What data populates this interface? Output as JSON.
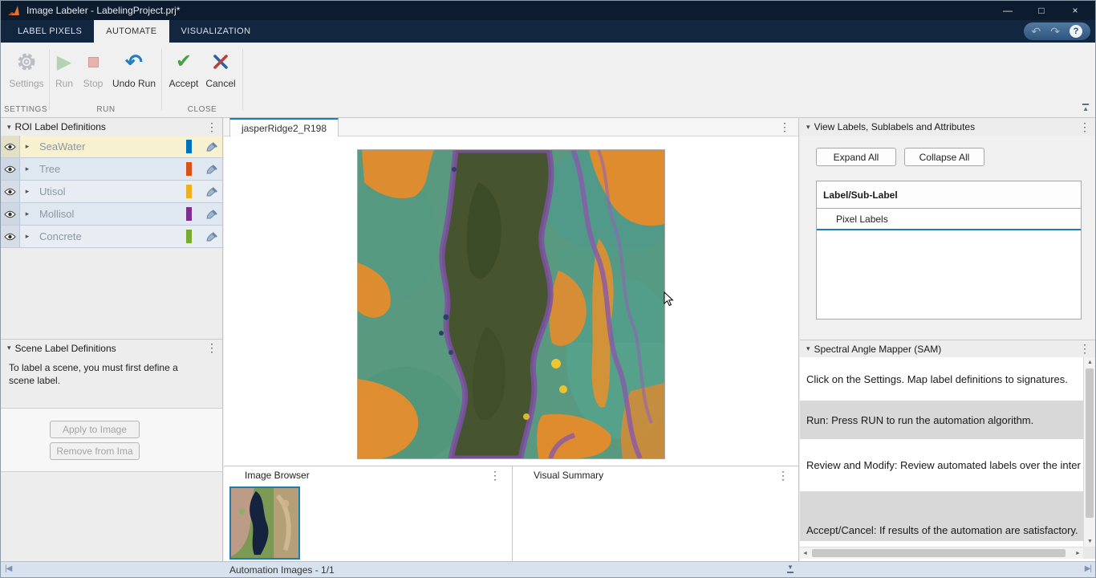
{
  "theme": {
    "titlebar_bg": "#0d1b2e",
    "accent_blue": "#1e7ab8",
    "selected_row_bg": "#f8f1cf"
  },
  "glyphs": {
    "collapse": "▾",
    "kebab": "⋮",
    "expander": "▸",
    "minimize": "—",
    "maximize": "□",
    "close": "×",
    "undo": "↶",
    "redo": "↷",
    "help": "?",
    "run": "▶",
    "accept": "✔",
    "scroll_up": "▲",
    "scroll_down": "▼",
    "scroll_left": "◄",
    "scroll_right": "►",
    "first_image": "|◀",
    "last_image": "▶|",
    "dock_down": "▼",
    "collapse_toolstrip": "▲"
  },
  "window": {
    "title": "Image Labeler - LabelingProject.prj*"
  },
  "ribbon": {
    "tabs": [
      {
        "label": "LABEL PIXELS"
      },
      {
        "label": "AUTOMATE"
      },
      {
        "label": "VISUALIZATION"
      }
    ],
    "groups": [
      {
        "caption": "SETTINGS"
      },
      {
        "caption": "RUN"
      },
      {
        "caption": "CLOSE"
      }
    ],
    "buttons": {
      "settings": "Settings",
      "run": "Run",
      "stop": "Stop",
      "undo_run": "Undo Run",
      "accept": "Accept",
      "cancel": "Cancel"
    }
  },
  "left": {
    "roi": {
      "title": "ROI Label Definitions",
      "labels": [
        {
          "name": "SeaWater",
          "color": "#0072BD",
          "selected": true
        },
        {
          "name": "Tree",
          "color": "#D95319",
          "selected": false
        },
        {
          "name": "Utisol",
          "color": "#EDB120",
          "selected": false
        },
        {
          "name": "Mollisol",
          "color": "#7E2F8E",
          "selected": false
        },
        {
          "name": "Concrete",
          "color": "#77AC30",
          "selected": false
        }
      ]
    },
    "scene": {
      "title": "Scene Label Definitions",
      "hint": "To label a scene, you must first define a scene label.",
      "apply": "Apply to Image",
      "remove": "Remove from Ima"
    }
  },
  "center": {
    "doc_tab": "jasperRidge2_R198",
    "image_browser_title": "Image Browser",
    "visual_summary_title": "Visual Summary"
  },
  "right": {
    "view_labels": {
      "title": "View Labels, Sublabels and Attributes",
      "expand": "Expand All",
      "collapse": "Collapse All",
      "column": "Label/Sub-Label",
      "rows": [
        {
          "label": "Pixel Labels"
        }
      ]
    },
    "sam": {
      "title": "Spectral Angle Mapper (SAM)",
      "steps": [
        {
          "text": "Click on the Settings. Map label definitions to signatures."
        },
        {
          "text": "Run: Press RUN to run the automation algorithm."
        },
        {
          "text": "Review and Modify: Review automated labels over the inter"
        },
        {
          "text": "Accept/Cancel: If results of the automation are satisfactory."
        }
      ]
    }
  },
  "statusbar": {
    "text": "Automation Images - 1/1"
  }
}
